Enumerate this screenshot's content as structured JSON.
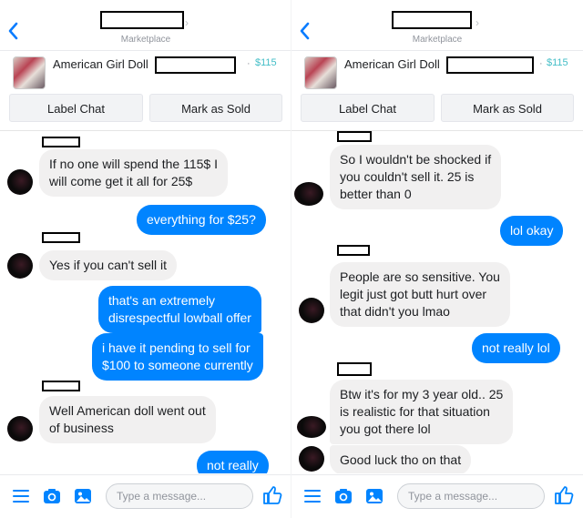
{
  "header": {
    "subtitle": "Marketplace"
  },
  "item": {
    "title": "American Girl Doll",
    "price": "$115",
    "dot": "·"
  },
  "buttons": {
    "label_chat": "Label Chat",
    "mark_as_sold": "Mark as Sold"
  },
  "composer": {
    "placeholder": "Type a message..."
  },
  "colors": {
    "accent": "#0084ff",
    "price": "#44bec7",
    "incoming_bubble": "#f1f0f0"
  },
  "left_chat": {
    "messages": [
      {
        "dir": "in",
        "lines": [
          "If no one will spend the 115$ I",
          "will come get it all for 25$"
        ]
      },
      {
        "dir": "out",
        "lines": [
          "everything for $25?"
        ]
      },
      {
        "dir": "in",
        "lines": [
          "Yes if you can't sell it"
        ]
      },
      {
        "dir": "out",
        "lines": [
          "that's an extremely",
          "disrespectful lowball offer"
        ]
      },
      {
        "dir": "out",
        "lines": [
          "i have it pending to sell for",
          "$100 to someone currently"
        ]
      },
      {
        "dir": "in",
        "lines": [
          "Well American doll went out",
          "of business"
        ]
      },
      {
        "dir": "out",
        "lines": [
          "not really"
        ]
      }
    ]
  },
  "right_chat": {
    "messages": [
      {
        "dir": "in",
        "lines": [
          "So I wouldn't be shocked if",
          "you couldn't sell it. 25 is",
          "better than 0"
        ]
      },
      {
        "dir": "out",
        "lines": [
          "lol okay"
        ]
      },
      {
        "dir": "in",
        "lines": [
          "People are so sensitive. You",
          "legit just got butt hurt over",
          "that didn't you lmao"
        ]
      },
      {
        "dir": "out",
        "lines": [
          "not really lol"
        ]
      },
      {
        "dir": "in",
        "lines": [
          "Btw it's for my 3 year old.. 25",
          "is realistic for that situation",
          "you got there lol"
        ]
      },
      {
        "dir": "in",
        "lines": [
          "Good luck tho on that"
        ]
      }
    ]
  }
}
